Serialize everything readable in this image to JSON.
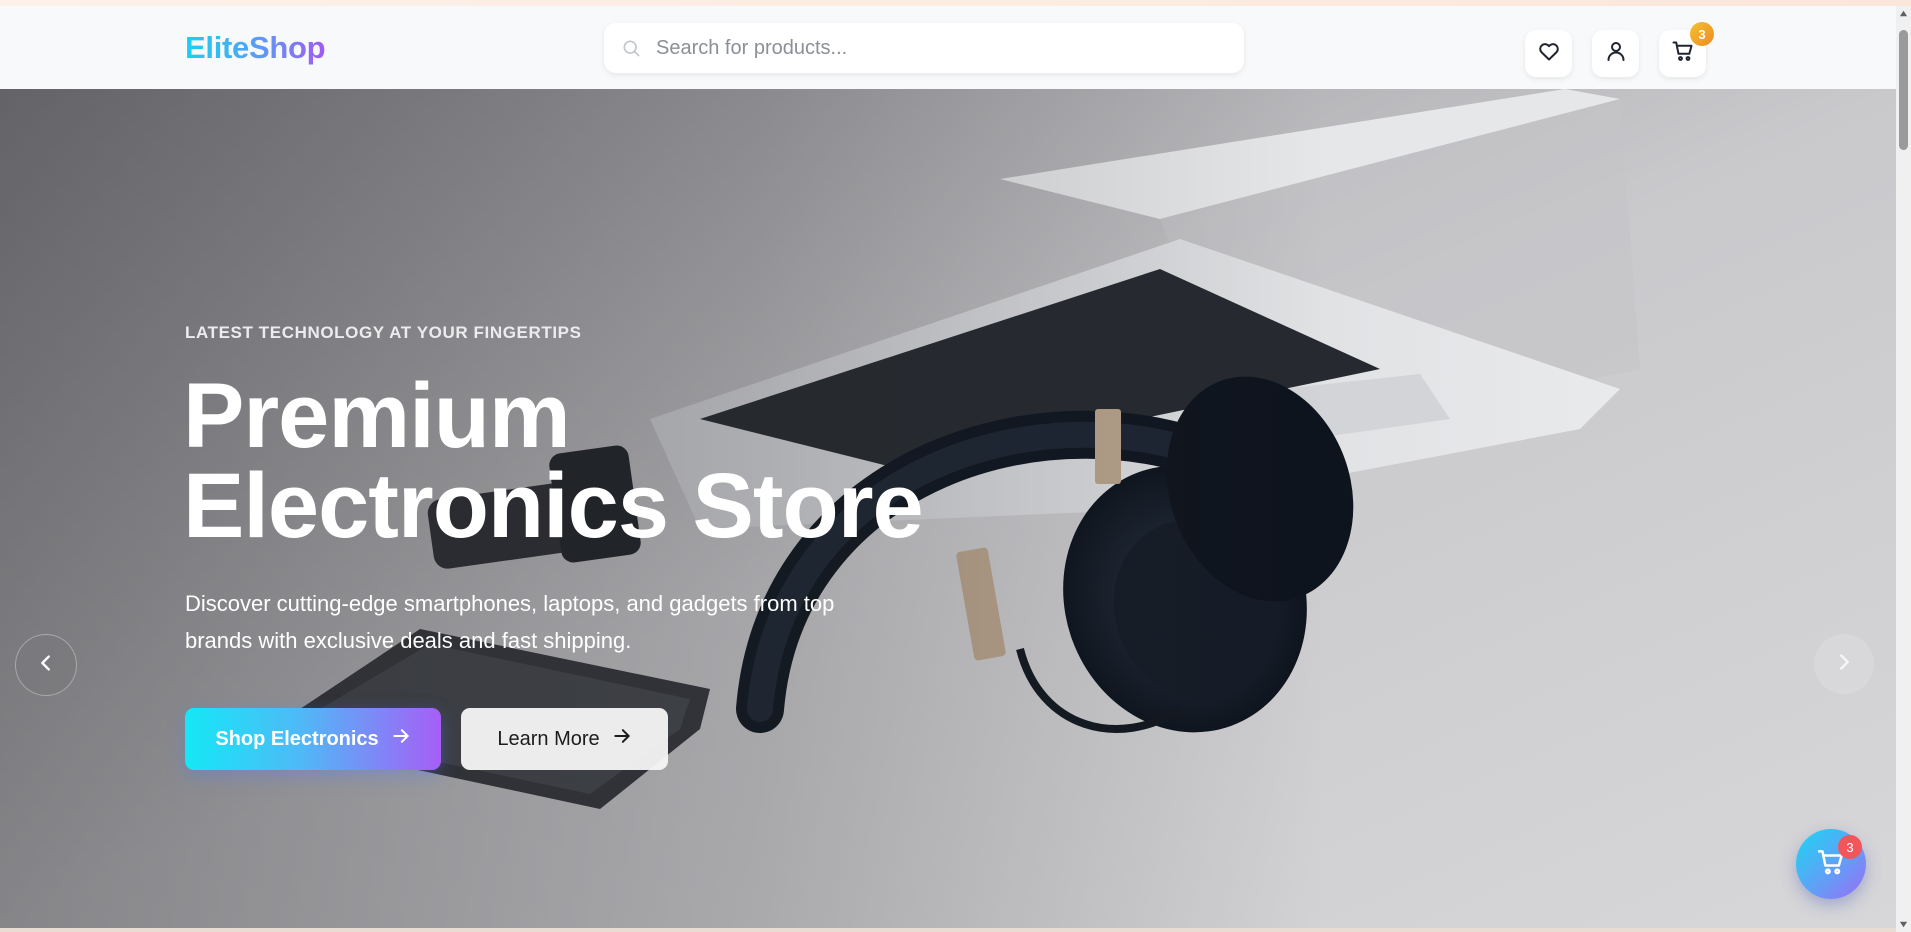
{
  "header": {
    "logo_text": "EliteShop",
    "search_placeholder": "Search for products...",
    "search_value": "",
    "wishlist_icon": "heart-icon",
    "account_icon": "user-icon",
    "cart_icon": "cart-icon",
    "cart_count": "3"
  },
  "hero": {
    "eyebrow": "LATEST TECHNOLOGY AT YOUR FINGERTIPS",
    "title_line1": "Premium",
    "title_line2": "Electronics Store",
    "subtitle": "Discover cutting-edge smartphones, laptops, and gadgets from top brands with exclusive deals and fast shipping.",
    "primary_cta": "Shop Electronics",
    "secondary_cta": "Learn More",
    "prev_icon": "chevron-left-icon",
    "next_icon": "chevron-right-icon"
  },
  "floating_cart": {
    "count": "3",
    "icon": "cart-icon"
  },
  "colors": {
    "brand_gradient_start": "#14e8f5",
    "brand_gradient_end": "#a65ef7",
    "cart_badge": "#f08a24",
    "float_badge": "#f2555a"
  }
}
